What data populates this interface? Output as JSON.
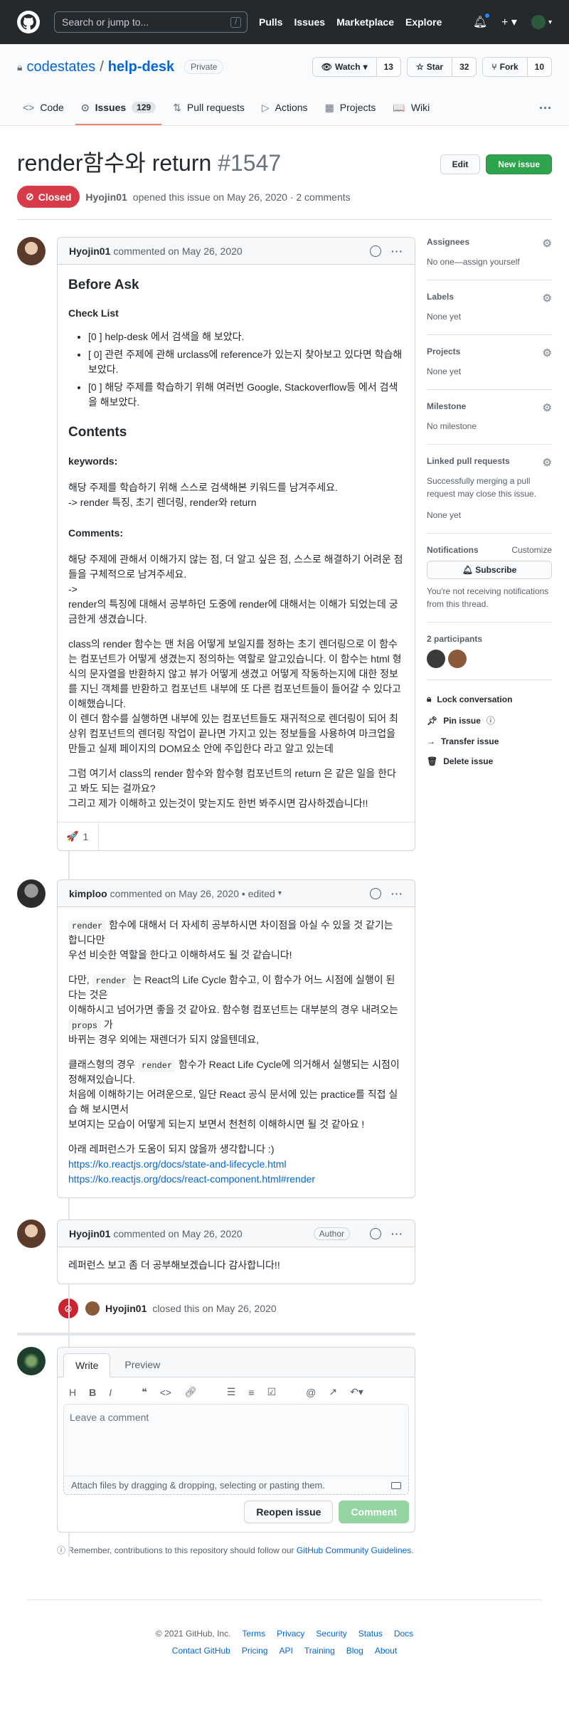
{
  "header": {
    "search_placeholder": "Search or jump to...",
    "slash_hint": "/",
    "nav": [
      "Pulls",
      "Issues",
      "Marketplace",
      "Explore"
    ],
    "plus": "+ ▾"
  },
  "repo": {
    "owner": "codestates",
    "sep": "/",
    "name": "help-desk",
    "visibility": "Private",
    "watch_label": "Watch",
    "watch_count": "13",
    "star_label": "Star",
    "star_count": "32",
    "fork_label": "Fork",
    "fork_count": "10"
  },
  "tabs": [
    {
      "label": "Code",
      "icon": "<>"
    },
    {
      "label": "Issues",
      "count": "129",
      "icon": "⊙"
    },
    {
      "label": "Pull requests",
      "icon": "⇅"
    },
    {
      "label": "Actions",
      "icon": "▷"
    },
    {
      "label": "Projects",
      "icon": "▦"
    },
    {
      "label": "Wiki",
      "icon": "📖"
    }
  ],
  "issue": {
    "title": "render함수와 return",
    "number": "#1547",
    "edit_label": "Edit",
    "new_label": "New issue",
    "state": "Closed",
    "author": "Hyojin01",
    "meta": "opened this issue on May 26, 2020 · 2 comments"
  },
  "comment1": {
    "author": "Hyojin01",
    "meta": "commented on May 26, 2020",
    "h_before": "Before Ask",
    "h_checklist": "Check List",
    "checklist": [
      "[0 ] help-desk 에서 검색을 해 보았다.",
      "[ 0] 관련 주제에 관해 urclass에 reference가 있는지 찾아보고 있다면 학습해보았다.",
      "[0 ] 해당 주제를 학습하기 위해 여러번 Google, Stackoverflow등 에서 검색을 해보았다."
    ],
    "h_contents": "Contents",
    "h_keywords": "keywords:",
    "keywords_p1": "해당 주제를 학습하기 위해 스스로 검색해본 키워드를 남겨주세요.",
    "keywords_p2": "-> render 특징, 초기 렌더링, render와 return",
    "h_comments": "Comments:",
    "c_p1": "해당 주제에 관해서 이해가지 않는 점, 더 알고 싶은 점, 스스로 해결하기 어려운 점들을 구체적으로 남겨주세요.",
    "c_p2": "->",
    "c_p3": "render의 특징에 대해서 공부하던 도중에 render에 대해서는 이해가 되었는데 궁금한게 생겼습니다.",
    "c_p4": "class의 render 함수는 맨 처음 어떻게 보일지를 정하는 초기 렌더링으로 이 함수는 컴포넌트가 어떻게 생겼는지 정의하는 역할로 알고있습니다. 이 함수는 html 형식의 문자열을 반환하지 않고 뷰가 어떻게 생겼고 어떻게 작동하는지에 대한 정보를 지닌 객체를 반환하고 컴포넌트 내부에 또 다른 컴포넌트들이 들어갈 수 있다고 이해했습니다.",
    "c_p5": "이 렌더 함수를 실행하면 내부에 있는 컴포넌트들도 재귀적으로 렌더링이 되어 최상위 컴포넌트의 렌더링 작업이 끝나면 가지고 있는 정보들을 사용하여 마크업을 만들고 실제 페이지의 DOM요소 안에 주입한다 라고 알고 있는데",
    "c_p6": "그럼 여기서 class의 render 함수와 함수형 컴포넌트의 return 은 같은 일을 한다고 봐도 되는 걸까요?",
    "c_p7": "그리고 제가 이해하고 있는것이 맞는지도 한번 봐주시면 감사하겠습니다!!",
    "reaction_emoji": "🚀",
    "reaction_count": "1"
  },
  "comment2": {
    "author": "kimploo",
    "meta": "commented on May 26, 2020 • edited",
    "code_render": "render",
    "code_props": "props",
    "p1a": " 함수에 대해서 더 자세히 공부하시면 차이점을 아실 수 있을 것 같기는 합니다만",
    "p1b": "우선 비슷한 역할을 한다고 이해하셔도 될 것 같습니다!",
    "p2a": "다만, ",
    "p2b": " 는 React의 Life Cycle 함수고, 이 함수가 어느 시점에 실행이 된다는 것은",
    "p2c": "이해하시고 넘어가면 좋을 것 같아요. 함수형 컴포넌트는 대부분의 경우 내려오는 ",
    "p2d": " 가",
    "p2e": "바뀌는 경우 외에는 재렌더가 되지 않을텐데요,",
    "p3a": "클래스형의 경우 ",
    "p3b": " 함수가 React Life Cycle에 의거해서 실행되는 시점이 정해져있습니다.",
    "p3c": "처음에 이해하기는 어려운으로, 일단 React 공식 문서에 있는 practice를 직접 실습 해 보시면서",
    "p3d": "보여지는 모습이 어떻게 되는지 보면서 천천히 이해하시면 될 것 같아요 !",
    "p4": "아래 레퍼런스가 도움이 되지 않을까 생각합니다 :)",
    "link1": "https://ko.reactjs.org/docs/state-and-lifecycle.html",
    "link2": "https://ko.reactjs.org/docs/react-component.html#render"
  },
  "comment3": {
    "author": "Hyojin01",
    "meta": "commented on May 26, 2020",
    "badge": "Author",
    "text": "레퍼런스 보고 좀 더 공부해보겠습니다 감사합니다!!"
  },
  "event": {
    "actor": "Hyojin01",
    "text": "closed this on May 26, 2020"
  },
  "new_comment": {
    "tab_write": "Write",
    "tab_preview": "Preview",
    "placeholder": "Leave a comment",
    "attach": "Attach files by dragging & dropping, selecting or pasting them.",
    "reopen": "Reopen issue",
    "submit": "Comment",
    "remember": "Remember, contributions to this repository should follow our",
    "guidelines": "GitHub Community Guidelines",
    "period": "."
  },
  "sidebar": {
    "assignees_t": "Assignees",
    "assignees_v": "No one—assign yourself",
    "labels_t": "Labels",
    "labels_v": "None yet",
    "projects_t": "Projects",
    "projects_v": "None yet",
    "milestone_t": "Milestone",
    "milestone_v": "No milestone",
    "linked_t": "Linked pull requests",
    "linked_desc": "Successfully merging a pull request may close this issue.",
    "linked_v": "None yet",
    "notif_t": "Notifications",
    "customize": "Customize",
    "subscribe": "Subscribe",
    "notif_desc": "You're not receiving notifications from this thread.",
    "participants_t": "2 participants",
    "lock": "Lock conversation",
    "pin": "Pin issue",
    "transfer": "Transfer issue",
    "delete": "Delete issue"
  },
  "footer": {
    "copyright": "© 2021 GitHub, Inc.",
    "row1": [
      "Terms",
      "Privacy",
      "Security",
      "Status",
      "Docs"
    ],
    "row2": [
      "Contact GitHub",
      "Pricing",
      "API",
      "Training",
      "Blog",
      "About"
    ]
  },
  "colors": {
    "closed": "#d73a49",
    "green": "#2ea44f",
    "link": "#0366d6",
    "tab_underline": "#f9826c"
  }
}
